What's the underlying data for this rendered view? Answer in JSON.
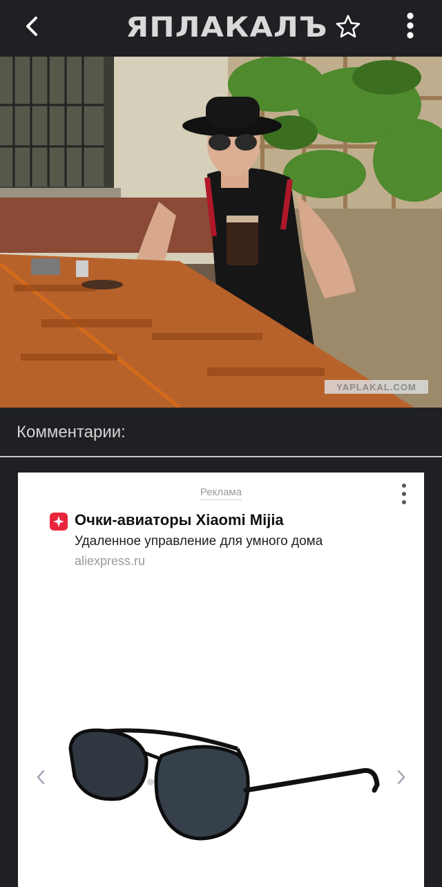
{
  "header": {
    "logo_text": "ЯПЛАКАЛЪ",
    "back_icon": "chevron-left-icon",
    "favorite_icon": "star-outline-icon",
    "menu_icon": "more-vertical-icon"
  },
  "photo": {
    "watermark": "YAPLAKAL.COM"
  },
  "comments": {
    "title": "Комментарии:"
  },
  "ad": {
    "label": "Реклама",
    "title": "Очки-авиаторы Xiaomi Mijia",
    "subtitle": "Удаленное управление для умного дома",
    "domain": "aliexpress.ru",
    "brand_color": "#e8253a"
  },
  "colors": {
    "background": "#1f2023",
    "text_light": "#d4d4d4",
    "divider": "#c9c9c9"
  }
}
